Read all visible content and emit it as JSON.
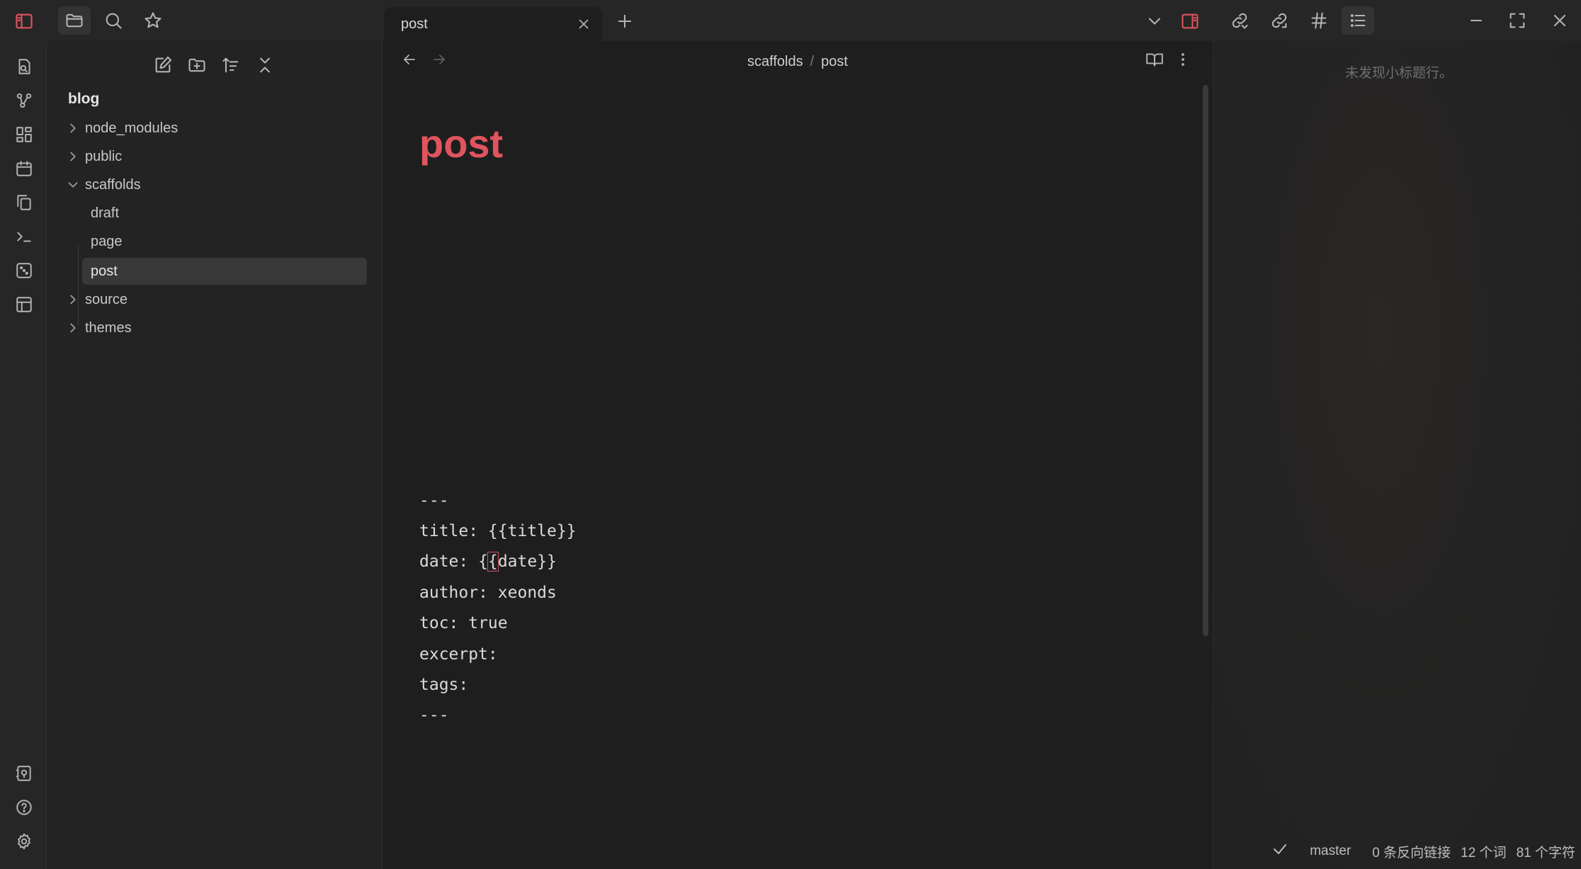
{
  "tab": {
    "title": "post"
  },
  "breadcrumb": {
    "folder": "scaffolds",
    "separator": "/",
    "file": "post"
  },
  "explorer": {
    "vault": "blog",
    "items": [
      {
        "label": "node_modules",
        "type": "folder",
        "expanded": false
      },
      {
        "label": "public",
        "type": "folder",
        "expanded": false
      },
      {
        "label": "scaffolds",
        "type": "folder",
        "expanded": true
      },
      {
        "label": "draft",
        "type": "file"
      },
      {
        "label": "page",
        "type": "file"
      },
      {
        "label": "post",
        "type": "file",
        "selected": true
      },
      {
        "label": "source",
        "type": "folder",
        "expanded": false
      },
      {
        "label": "themes",
        "type": "folder",
        "expanded": false
      }
    ]
  },
  "editor": {
    "title": "post",
    "lines": [
      "---",
      "title: {{title}}",
      "date: ",
      "author: xeonds",
      "toc: true",
      "excerpt:",
      "tags:",
      "---"
    ],
    "date_cursor_char": "{",
    "date_rest": "date}}",
    "date_prefix_brace": "{"
  },
  "outline": {
    "empty_text": "未发现小标题行。"
  },
  "status": {
    "branch": "master",
    "backlinks": "0 条反向链接",
    "words": "12 个词",
    "chars": "81 个字符"
  },
  "icons": {
    "ribbon": [
      "sidebar-toggle-icon",
      "quick-switcher-icon",
      "graph-icon",
      "canvas-icon",
      "daily-note-icon",
      "templates-icon",
      "command-palette-icon",
      "random-note-icon",
      "slides-icon",
      "vault-switch-icon",
      "help-icon",
      "settings-icon"
    ]
  },
  "colors": {
    "accent": "#e0545e",
    "background": "#1e1e1e",
    "sidebar": "#232323"
  }
}
